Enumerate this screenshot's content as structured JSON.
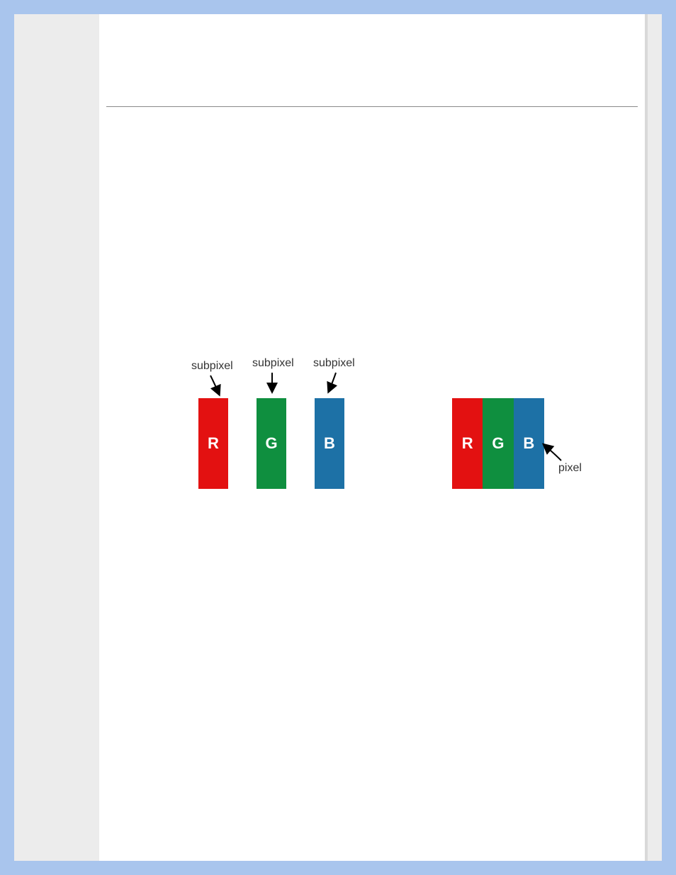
{
  "diagram": {
    "subpixels": [
      {
        "label": "subpixel",
        "letter": "R",
        "color": "#e31111"
      },
      {
        "label": "subpixel",
        "letter": "G",
        "color": "#0f8f3f"
      },
      {
        "label": "subpixel",
        "letter": "B",
        "color": "#1d71a6"
      }
    ],
    "pixel": {
      "label": "pixel",
      "letters": [
        "R",
        "G",
        "B"
      ],
      "colors": [
        "#e31111",
        "#0f8f3f",
        "#1d71a6"
      ]
    }
  }
}
